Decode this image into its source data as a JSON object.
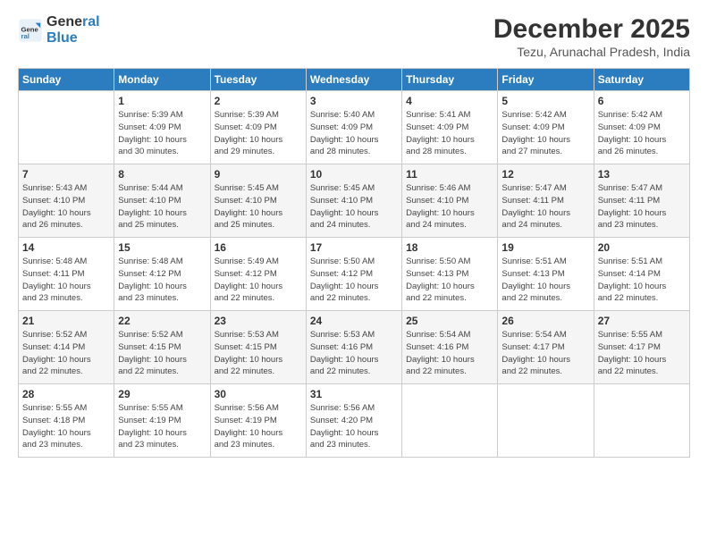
{
  "header": {
    "logo_general": "General",
    "logo_blue": "Blue",
    "title": "December 2025",
    "subtitle": "Tezu, Arunachal Pradesh, India"
  },
  "calendar": {
    "days_of_week": [
      "Sunday",
      "Monday",
      "Tuesday",
      "Wednesday",
      "Thursday",
      "Friday",
      "Saturday"
    ],
    "weeks": [
      {
        "alt": false,
        "cells": [
          {
            "day": "",
            "info": ""
          },
          {
            "day": "1",
            "info": "Sunrise: 5:39 AM\nSunset: 4:09 PM\nDaylight: 10 hours\nand 30 minutes."
          },
          {
            "day": "2",
            "info": "Sunrise: 5:39 AM\nSunset: 4:09 PM\nDaylight: 10 hours\nand 29 minutes."
          },
          {
            "day": "3",
            "info": "Sunrise: 5:40 AM\nSunset: 4:09 PM\nDaylight: 10 hours\nand 28 minutes."
          },
          {
            "day": "4",
            "info": "Sunrise: 5:41 AM\nSunset: 4:09 PM\nDaylight: 10 hours\nand 28 minutes."
          },
          {
            "day": "5",
            "info": "Sunrise: 5:42 AM\nSunset: 4:09 PM\nDaylight: 10 hours\nand 27 minutes."
          },
          {
            "day": "6",
            "info": "Sunrise: 5:42 AM\nSunset: 4:09 PM\nDaylight: 10 hours\nand 26 minutes."
          }
        ]
      },
      {
        "alt": true,
        "cells": [
          {
            "day": "7",
            "info": "Sunrise: 5:43 AM\nSunset: 4:10 PM\nDaylight: 10 hours\nand 26 minutes."
          },
          {
            "day": "8",
            "info": "Sunrise: 5:44 AM\nSunset: 4:10 PM\nDaylight: 10 hours\nand 25 minutes."
          },
          {
            "day": "9",
            "info": "Sunrise: 5:45 AM\nSunset: 4:10 PM\nDaylight: 10 hours\nand 25 minutes."
          },
          {
            "day": "10",
            "info": "Sunrise: 5:45 AM\nSunset: 4:10 PM\nDaylight: 10 hours\nand 24 minutes."
          },
          {
            "day": "11",
            "info": "Sunrise: 5:46 AM\nSunset: 4:10 PM\nDaylight: 10 hours\nand 24 minutes."
          },
          {
            "day": "12",
            "info": "Sunrise: 5:47 AM\nSunset: 4:11 PM\nDaylight: 10 hours\nand 24 minutes."
          },
          {
            "day": "13",
            "info": "Sunrise: 5:47 AM\nSunset: 4:11 PM\nDaylight: 10 hours\nand 23 minutes."
          }
        ]
      },
      {
        "alt": false,
        "cells": [
          {
            "day": "14",
            "info": "Sunrise: 5:48 AM\nSunset: 4:11 PM\nDaylight: 10 hours\nand 23 minutes."
          },
          {
            "day": "15",
            "info": "Sunrise: 5:48 AM\nSunset: 4:12 PM\nDaylight: 10 hours\nand 23 minutes."
          },
          {
            "day": "16",
            "info": "Sunrise: 5:49 AM\nSunset: 4:12 PM\nDaylight: 10 hours\nand 22 minutes."
          },
          {
            "day": "17",
            "info": "Sunrise: 5:50 AM\nSunset: 4:12 PM\nDaylight: 10 hours\nand 22 minutes."
          },
          {
            "day": "18",
            "info": "Sunrise: 5:50 AM\nSunset: 4:13 PM\nDaylight: 10 hours\nand 22 minutes."
          },
          {
            "day": "19",
            "info": "Sunrise: 5:51 AM\nSunset: 4:13 PM\nDaylight: 10 hours\nand 22 minutes."
          },
          {
            "day": "20",
            "info": "Sunrise: 5:51 AM\nSunset: 4:14 PM\nDaylight: 10 hours\nand 22 minutes."
          }
        ]
      },
      {
        "alt": true,
        "cells": [
          {
            "day": "21",
            "info": "Sunrise: 5:52 AM\nSunset: 4:14 PM\nDaylight: 10 hours\nand 22 minutes."
          },
          {
            "day": "22",
            "info": "Sunrise: 5:52 AM\nSunset: 4:15 PM\nDaylight: 10 hours\nand 22 minutes."
          },
          {
            "day": "23",
            "info": "Sunrise: 5:53 AM\nSunset: 4:15 PM\nDaylight: 10 hours\nand 22 minutes."
          },
          {
            "day": "24",
            "info": "Sunrise: 5:53 AM\nSunset: 4:16 PM\nDaylight: 10 hours\nand 22 minutes."
          },
          {
            "day": "25",
            "info": "Sunrise: 5:54 AM\nSunset: 4:16 PM\nDaylight: 10 hours\nand 22 minutes."
          },
          {
            "day": "26",
            "info": "Sunrise: 5:54 AM\nSunset: 4:17 PM\nDaylight: 10 hours\nand 22 minutes."
          },
          {
            "day": "27",
            "info": "Sunrise: 5:55 AM\nSunset: 4:17 PM\nDaylight: 10 hours\nand 22 minutes."
          }
        ]
      },
      {
        "alt": false,
        "cells": [
          {
            "day": "28",
            "info": "Sunrise: 5:55 AM\nSunset: 4:18 PM\nDaylight: 10 hours\nand 23 minutes."
          },
          {
            "day": "29",
            "info": "Sunrise: 5:55 AM\nSunset: 4:19 PM\nDaylight: 10 hours\nand 23 minutes."
          },
          {
            "day": "30",
            "info": "Sunrise: 5:56 AM\nSunset: 4:19 PM\nDaylight: 10 hours\nand 23 minutes."
          },
          {
            "day": "31",
            "info": "Sunrise: 5:56 AM\nSunset: 4:20 PM\nDaylight: 10 hours\nand 23 minutes."
          },
          {
            "day": "",
            "info": ""
          },
          {
            "day": "",
            "info": ""
          },
          {
            "day": "",
            "info": ""
          }
        ]
      }
    ]
  }
}
